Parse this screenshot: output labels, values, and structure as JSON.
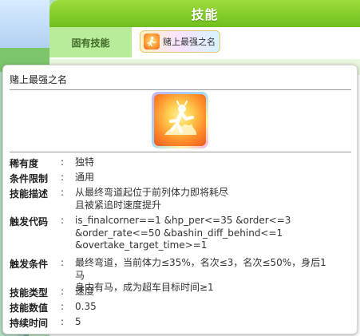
{
  "panel": {
    "header_title": "技能",
    "row_label": "固有技能",
    "skill_chip_label": "赌上最强之名"
  },
  "tooltip": {
    "title": "赌上最强之名",
    "icon": "running-horse-girl-icon",
    "rows": [
      {
        "key": "稀有度",
        "colon": ":",
        "value": "独特"
      },
      {
        "key": "条件限制",
        "colon": ":",
        "value": "通用"
      },
      {
        "key": "技能描述",
        "colon": ":",
        "value": "从最终弯道起位于前列体力即将耗尽\n且被紧追时速度提升"
      },
      {
        "key": "触发代码",
        "colon": ":",
        "value": "is_finalcorner==1 &hp_per<=35 &order<=3\n&order_rate<=50 &bashin_diff_behind<=1\n&overtake_target_time>=1"
      },
      {
        "key": "触发条件",
        "colon": ":",
        "value": "最终弯道，当前体力≤35%，名次≤3，名次≤50%，身后1马\n身内有马，成为超车目标时间≥1"
      },
      {
        "key": "技能类型",
        "colon": ":",
        "value": "速度"
      },
      {
        "key": "技能数值",
        "colon": ":",
        "value": "0.35"
      },
      {
        "key": "持续时间",
        "colon": ":",
        "value": "5"
      }
    ]
  },
  "colors": {
    "header_green": "#7cc72a",
    "row_label_green": "#b8ec98",
    "icon_orange": "#ff8c2a"
  }
}
